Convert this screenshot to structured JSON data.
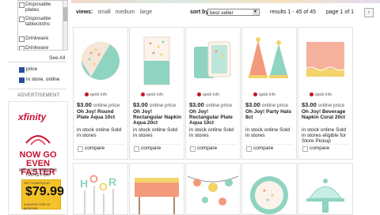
{
  "sidebar": {
    "checkbox_items": [
      "Disposable plates",
      "Disposable tablecloths",
      "Drinkware",
      "Drinkware"
    ],
    "see_all": "See All",
    "filters": [
      "price",
      "in store, online"
    ],
    "advertisement_label": "ADVERTISEMENT"
  },
  "ad": {
    "brand": "xfinity",
    "headline": "NOW GO EVEN FASTER",
    "subline": "WITH THE XFINITY® TRIPLE PLAY",
    "price_caption": "GET STARTED AT",
    "price": "$79.99",
    "price_sub": "A MONTH FOR 12 MONTHS"
  },
  "toolbar": {
    "views_label": "views:",
    "view_small": "small",
    "view_medium": "medium",
    "view_large": "large",
    "sort_label": "sort by:",
    "sort_value": "best seller",
    "results": "results 1 - 45 of 45",
    "page": "page 1 of 1",
    "next": "›"
  },
  "products": [
    {
      "price": "$3.00",
      "price_suffix": "online price",
      "quick_info": "quick info",
      "title": "Oh Joy! Round Plate Aqua 10ct",
      "stock": "in stock online Sold in stores",
      "compare": "compare"
    },
    {
      "price": "$3.00",
      "price_suffix": "online price",
      "quick_info": "quick info",
      "title": "Oh Joy! Rectangular Napkin Aqua 20ct",
      "stock": "in stock online Sold in stores",
      "compare": "compare"
    },
    {
      "price": "$3.00",
      "price_suffix": "online price",
      "quick_info": "quick info",
      "title": "Oh Joy! Rectangular Plate Aqua 10ct",
      "stock": "in stock online Sold in stores",
      "compare": "compare"
    },
    {
      "price": "$3.00",
      "price_suffix": "online price",
      "quick_info": "quick info",
      "title": "Oh Joy! Party Hats 8ct",
      "stock": "in stock online Sold in stores",
      "compare": "compare"
    },
    {
      "price": "$3.00",
      "price_suffix": "online price",
      "quick_info": "quick info",
      "title": "Oh Joy! Beverage Napkin Coral 20ct",
      "stock": "in stock online Sold in stores eligible for Store Pickup",
      "compare": "compare"
    }
  ],
  "colors": {
    "aqua": "#8fd3c1",
    "coral": "#f39a7c",
    "yellow": "#f3d36a",
    "brand_red": "#c8102e"
  }
}
